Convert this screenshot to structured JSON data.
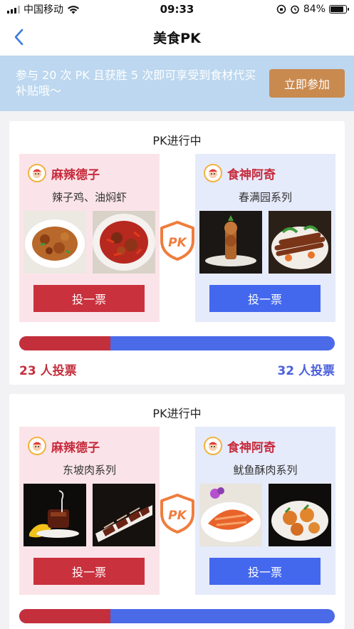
{
  "status_bar": {
    "carrier": "中国移动",
    "time": "09:33",
    "battery": "84%",
    "battery_level": 0.84
  },
  "nav": {
    "title": "美食PK"
  },
  "banner": {
    "text": "参与 20 次 PK 且获胜 5 次即可享受到食材代买补贴哦～",
    "button": "立即参加"
  },
  "colors": {
    "left_accent": "#c9313d",
    "right_accent": "#4368ee",
    "join": "#c98a4f",
    "banner_bg": "#bcd7ef"
  },
  "pk_cards": [
    {
      "title": "PK进行中",
      "left": {
        "brand": "麻辣德子",
        "series": "辣子鸡、油焖虾",
        "vote_label": "投一票",
        "votes_text": "23 人投票"
      },
      "right": {
        "brand": "食神阿奇",
        "series": "春满园系列",
        "vote_label": "投一票",
        "votes_text": "32 人投票"
      },
      "left_share": 0.29
    },
    {
      "title": "PK进行中",
      "left": {
        "brand": "麻辣德子",
        "series": "东坡肉系列",
        "vote_label": "投一票"
      },
      "right": {
        "brand": "食神阿奇",
        "series": "鱿鱼酥肉系列",
        "vote_label": "投一票"
      },
      "left_share": 0.29
    }
  ],
  "badge_text": "PK"
}
